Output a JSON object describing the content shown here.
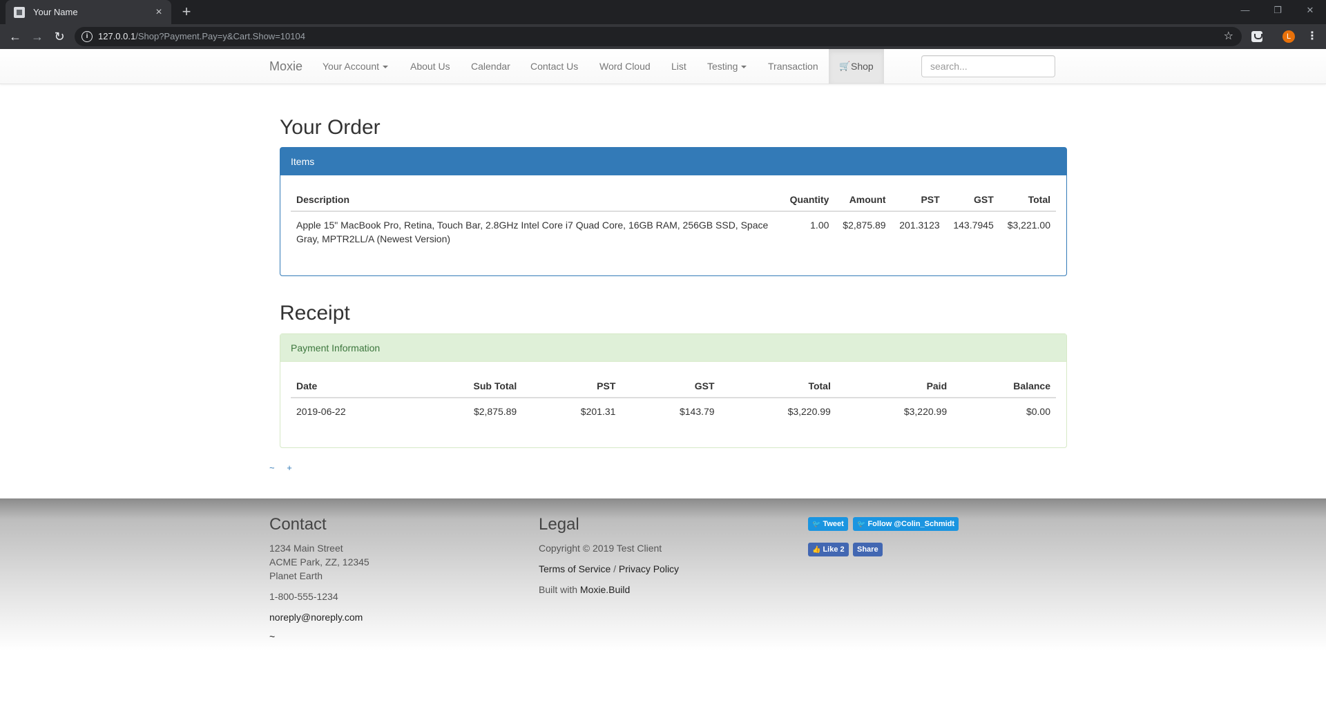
{
  "browser": {
    "tab_title": "Your Name",
    "new_tab": "+",
    "url_host": "127.0.0.1",
    "url_path": "/Shop?Payment.Pay=y&Cart.Show=10104",
    "avatar_letter": "L"
  },
  "navbar": {
    "brand": "Moxie",
    "items": {
      "your_account": "Your Account",
      "about": "About Us",
      "calendar": "Calendar",
      "contact": "Contact Us",
      "word_cloud": "Word Cloud",
      "list": "List",
      "testing": "Testing",
      "transaction": "Transaction",
      "shop": "Shop"
    },
    "search_placeholder": "search..."
  },
  "order": {
    "title": "Your Order",
    "panel_heading": "Items",
    "headers": {
      "description": "Description",
      "quantity": "Quantity",
      "amount": "Amount",
      "pst": "PST",
      "gst": "GST",
      "total": "Total"
    },
    "rows": [
      {
        "description_line1": "Apple 15\" MacBook Pro, Retina, Touch Bar, 2.8GHz Intel Core i7 Quad Core, 16GB RAM, 256GB SSD, Space",
        "description_line2": "Gray, MPTR2LL/A (Newest Version)",
        "quantity": "1.00",
        "amount": "$2,875.89",
        "pst": "201.3123",
        "gst": "143.7945",
        "total": "$3,221.00"
      }
    ]
  },
  "receipt": {
    "title": "Receipt",
    "panel_heading": "Payment Information",
    "headers": {
      "date": "Date",
      "sub_total": "Sub Total",
      "pst": "PST",
      "gst": "GST",
      "total": "Total",
      "paid": "Paid",
      "balance": "Balance"
    },
    "rows": [
      {
        "date": "2019-06-22",
        "sub_total": "$2,875.89",
        "pst": "$201.31",
        "gst": "$143.79",
        "total": "$3,220.99",
        "paid": "$3,220.99",
        "balance": "$0.00"
      }
    ]
  },
  "page_links": {
    "tilde": "~",
    "plus": "+"
  },
  "footer": {
    "contact": {
      "heading": "Contact",
      "address1": "1234 Main Street",
      "address2": "ACME Park, ZZ, 12345",
      "address3": "Planet Earth",
      "phone": "1-800-555-1234",
      "email": "noreply@noreply.com",
      "tilde": "~"
    },
    "legal": {
      "heading": "Legal",
      "copyright": "Copyright © 2019 Test Client",
      "terms": "Terms of Service",
      "separator": "/",
      "privacy": "Privacy Policy",
      "built_with": "Built with",
      "built_link": "Moxie.Build"
    },
    "social": {
      "tweet": "Tweet",
      "follow": "Follow @Colin_Schmidt",
      "like": "Like 2",
      "share": "Share"
    }
  },
  "colors": {
    "primary": "#337ab7",
    "success_bg": "#dff0d8",
    "success_text": "#3c763d",
    "twitter": "#1b95e0",
    "facebook": "#4267b2",
    "avatar": "#e8710a"
  }
}
